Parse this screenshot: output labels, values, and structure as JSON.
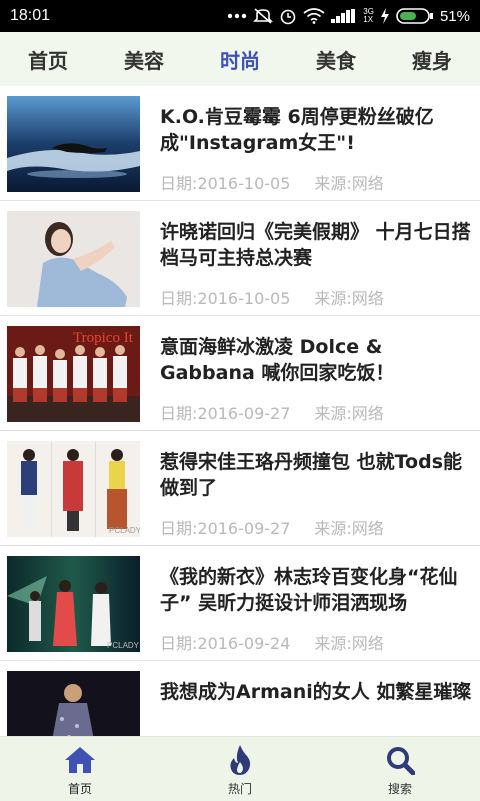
{
  "status_bar": {
    "time": "18:01",
    "network": "3G\n1X",
    "battery": "51%"
  },
  "tabs": [
    {
      "label": "首页"
    },
    {
      "label": "美容"
    },
    {
      "label": "时尚"
    },
    {
      "label": "美食"
    },
    {
      "label": "瘦身"
    }
  ],
  "active_tab": "时尚",
  "articles": [
    {
      "title": "K.O.肯豆霉霉 6周停更粉丝破亿成\"Instagram女王\"!",
      "date": "日期:2016-10-05",
      "source": "来源:网络"
    },
    {
      "title": "许晓诺回归《完美假期》 十月七日搭档马可主持总决赛",
      "date": "日期:2016-10-05",
      "source": "来源:网络"
    },
    {
      "title": "意面海鲜冰激凌 Dolce & Gabbana 喊你回家吃饭！",
      "date": "日期:2016-09-27",
      "source": "来源:网络",
      "image_text": "Tropico It"
    },
    {
      "title": "惹得宋佳王珞丹频撞包 也就Tods能做到了",
      "date": "日期:2016-09-27",
      "source": "来源:网络",
      "image_text": "PCLADY"
    },
    {
      "title": "《我的新衣》林志玲百变化身“花仙子” 吴昕力挺设计师泪洒现场",
      "date": "日期:2016-09-24",
      "source": "来源:网络",
      "image_text": "PCLADY"
    },
    {
      "title": "我想成为Armani的女人 如繁星璀璨",
      "date": "",
      "source": ""
    }
  ],
  "bottom_nav": [
    {
      "label": "首页",
      "icon": "home-icon"
    },
    {
      "label": "热门",
      "icon": "flame-icon"
    },
    {
      "label": "搜索",
      "icon": "search-icon"
    }
  ],
  "colors": {
    "accent": "#3f51b5",
    "tab_bar_bg": "#f1f7ec",
    "nav_bg": "#eef4e7",
    "meta_text": "#b9b9b9"
  }
}
